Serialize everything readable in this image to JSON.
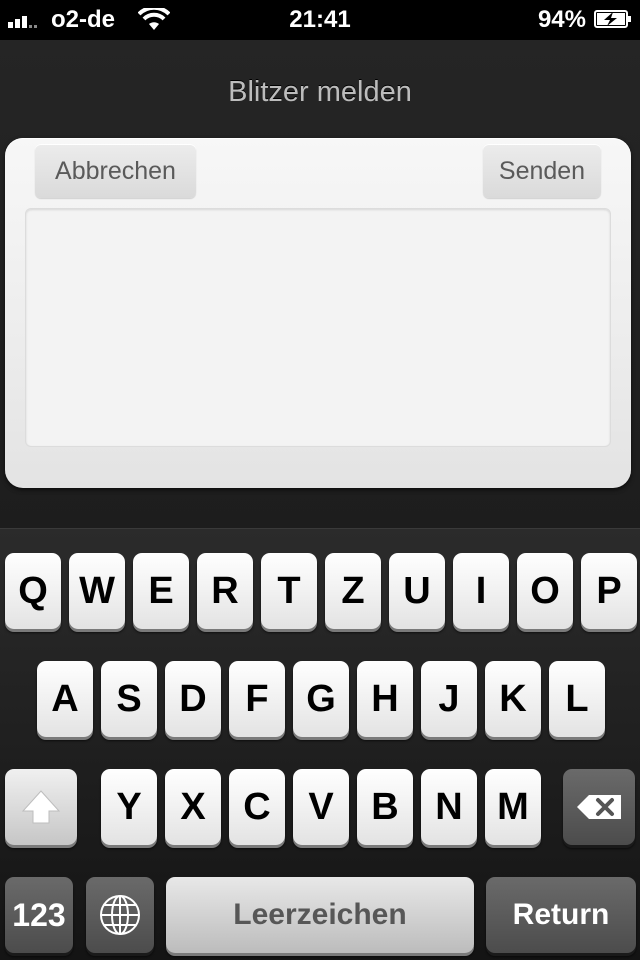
{
  "status_bar": {
    "carrier": "o2-de",
    "time": "21:41",
    "battery": "94%",
    "battery_level": 0.94,
    "signal_bars": 3,
    "icons": [
      "signal-icon",
      "wifi-icon",
      "battery-charging-icon"
    ]
  },
  "sheet": {
    "title": "Blitzer melden",
    "cancel_label": "Abbrechen",
    "send_label": "Senden",
    "message_value": ""
  },
  "keyboard": {
    "row1": [
      "Q",
      "W",
      "E",
      "R",
      "T",
      "Z",
      "U",
      "I",
      "O",
      "P"
    ],
    "row2": [
      "A",
      "S",
      "D",
      "F",
      "G",
      "H",
      "J",
      "K",
      "L"
    ],
    "row3": [
      "Y",
      "X",
      "C",
      "V",
      "B",
      "N",
      "M"
    ],
    "numbers_label": "123",
    "space_label": "Leerzeichen",
    "return_label": "Return",
    "icons": [
      "shift-icon",
      "delete-icon",
      "globe-icon"
    ]
  }
}
